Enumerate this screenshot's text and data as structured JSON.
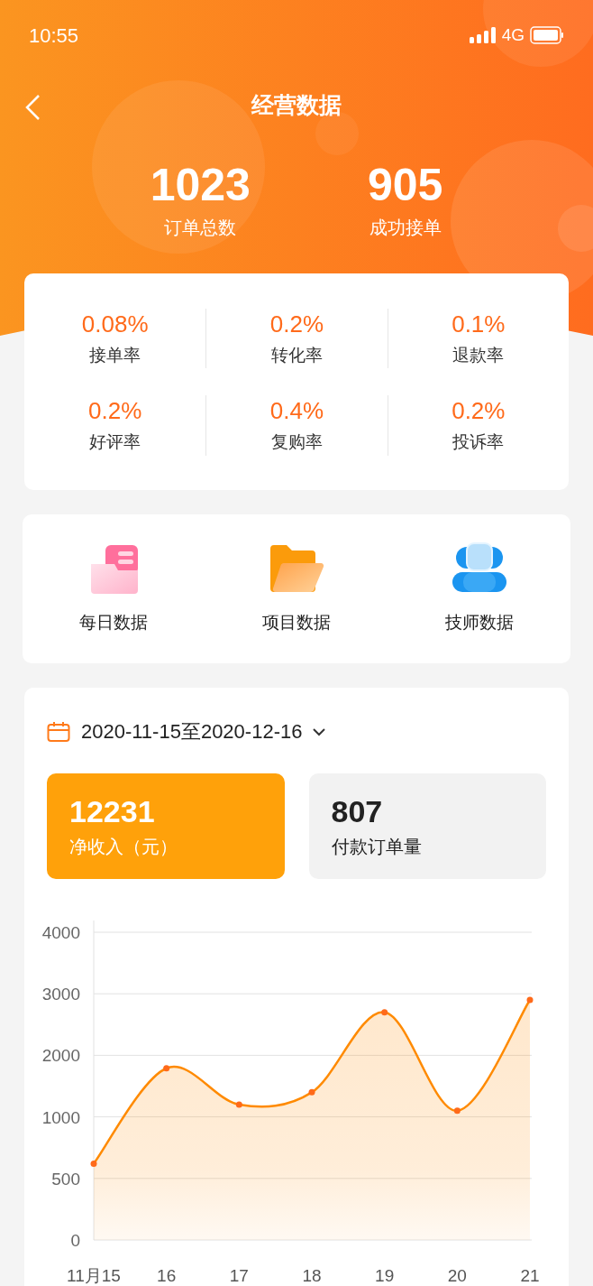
{
  "status_bar": {
    "time": "10:55",
    "network": "4G"
  },
  "nav": {
    "title": "经营数据"
  },
  "summary": [
    {
      "value": "1023",
      "label": "订单总数"
    },
    {
      "value": "905",
      "label": "成功接单"
    }
  ],
  "rates": [
    {
      "value": "0.08%",
      "label": "接单率"
    },
    {
      "value": "0.2%",
      "label": "转化率"
    },
    {
      "value": "0.1%",
      "label": "退款率"
    },
    {
      "value": "0.2%",
      "label": "好评率"
    },
    {
      "value": "0.4%",
      "label": "复购率"
    },
    {
      "value": "0.2%",
      "label": "投诉率"
    }
  ],
  "shortcuts": [
    {
      "kind": "daily",
      "label": "每日数据"
    },
    {
      "kind": "project",
      "label": "项目数据"
    },
    {
      "kind": "technician",
      "label": "技师数据"
    }
  ],
  "date_range": "2020-11-15至2020-12-16",
  "tiles": [
    {
      "value": "12231",
      "label": "净收入（元）",
      "selected": true
    },
    {
      "value": "807",
      "label": "付款订单量",
      "selected": false
    }
  ],
  "trend_chart": {
    "x_axis_labels": [
      "11月15",
      "16",
      "17",
      "18",
      "19",
      "20",
      "21"
    ],
    "y_axis_labels": [
      "4000",
      "3000",
      "2000",
      "1000",
      "500",
      "0"
    ]
  }
}
